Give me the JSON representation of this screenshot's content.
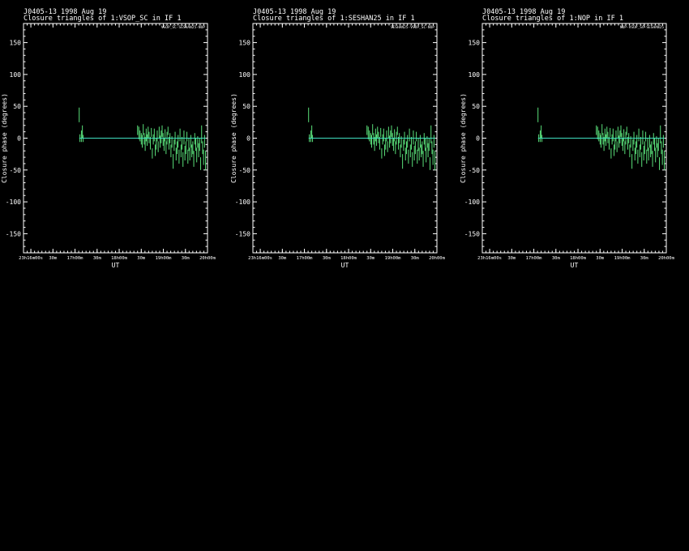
{
  "chart_data": [
    {
      "type": "scatter",
      "header": "J0405-13  1998 Aug 19",
      "title": "Closure triangles of 1:VSOP_SC in IF 1",
      "corner_label": "VSOP_SC-SESHAN25-NOP",
      "xlabel": "UT",
      "ylabel": "Closure phase   (degrees)",
      "ylim": [
        -180,
        180
      ],
      "yticks": [
        -150,
        -100,
        -50,
        0,
        50,
        100,
        150
      ],
      "xlim": [
        -60,
        1440
      ],
      "xticks": [
        0,
        180,
        360,
        540,
        720,
        900,
        1080,
        1260,
        1440
      ],
      "xtick_labels": [
        "23h16m00s",
        "30m",
        "17h00m",
        "30m",
        "18h00m",
        "30m",
        "19h00m",
        "30m",
        "20h00m"
      ],
      "model_line": {
        "y": 0,
        "x_start": 394,
        "x_end": 1425,
        "color": "#40e0c0"
      },
      "bar_color": "#5ae07a"
    },
    {
      "type": "scatter",
      "header": "J0405-13  1998 Aug 19",
      "title": "Closure triangles of 1:SESHAN25 in IF 1",
      "corner_label": "SESHAN25-VSOP_SC-NOP",
      "xlabel": "UT",
      "ylabel": "Closure phase   (degrees)",
      "ylim": [
        -180,
        180
      ],
      "yticks": [
        -150,
        -100,
        -50,
        0,
        50,
        100,
        150
      ],
      "xlim": [
        -60,
        1440
      ],
      "xticks": [
        0,
        180,
        360,
        540,
        720,
        900,
        1080,
        1260,
        1440
      ],
      "xtick_labels": [
        "23h16m00s",
        "30m",
        "17h00m",
        "30m",
        "18h00m",
        "30m",
        "19h00m",
        "30m",
        "20h00m"
      ],
      "model_line": {
        "y": 0,
        "x_start": 394,
        "x_end": 1425,
        "color": "#40e0c0"
      },
      "bar_color": "#5ae07a"
    },
    {
      "type": "scatter",
      "header": "J0405-13  1998 Aug 19",
      "title": "Closure triangles of 1:NOP in IF 1",
      "corner_label": "NOP-VSOP_SC-SESHAN25",
      "xlabel": "UT",
      "ylabel": "Closure phase   (degrees)",
      "ylim": [
        -180,
        180
      ],
      "yticks": [
        -150,
        -100,
        -50,
        0,
        50,
        100,
        150
      ],
      "xlim": [
        -60,
        1440
      ],
      "xticks": [
        0,
        180,
        360,
        540,
        720,
        900,
        1080,
        1260,
        1440
      ],
      "xtick_labels": [
        "23h16m00s",
        "30m",
        "17h00m",
        "30m",
        "18h00m",
        "30m",
        "19h00m",
        "30m",
        "20h00m"
      ],
      "model_line": {
        "y": 0,
        "x_start": 394,
        "x_end": 1425,
        "color": "#40e0c0"
      },
      "bar_color": "#5ae07a"
    }
  ],
  "points": [
    {
      "x": 394,
      "lo": 25,
      "hi": 48
    },
    {
      "x": 400,
      "lo": -6,
      "hi": 6
    },
    {
      "x": 412,
      "lo": -6,
      "hi": 12
    },
    {
      "x": 420,
      "lo": 0,
      "hi": 20
    },
    {
      "x": 426,
      "lo": -6,
      "hi": 5
    },
    {
      "x": 870,
      "lo": 5,
      "hi": 20
    },
    {
      "x": 880,
      "lo": -2,
      "hi": 18
    },
    {
      "x": 890,
      "lo": -5,
      "hi": 12
    },
    {
      "x": 900,
      "lo": -10,
      "hi": 8
    },
    {
      "x": 908,
      "lo": -15,
      "hi": 5
    },
    {
      "x": 916,
      "lo": 5,
      "hi": 22
    },
    {
      "x": 924,
      "lo": -10,
      "hi": 8
    },
    {
      "x": 932,
      "lo": -20,
      "hi": 2
    },
    {
      "x": 940,
      "lo": -5,
      "hi": 15
    },
    {
      "x": 948,
      "lo": -12,
      "hi": 6
    },
    {
      "x": 956,
      "lo": 0,
      "hi": 18
    },
    {
      "x": 964,
      "lo": -8,
      "hi": 10
    },
    {
      "x": 974,
      "lo": -18,
      "hi": 2
    },
    {
      "x": 982,
      "lo": 2,
      "hi": 16
    },
    {
      "x": 990,
      "lo": -32,
      "hi": -16
    },
    {
      "x": 998,
      "lo": -10,
      "hi": 6
    },
    {
      "x": 1006,
      "lo": -5,
      "hi": 15
    },
    {
      "x": 1014,
      "lo": -28,
      "hi": -10
    },
    {
      "x": 1022,
      "lo": -18,
      "hi": 0
    },
    {
      "x": 1030,
      "lo": -5,
      "hi": 12
    },
    {
      "x": 1038,
      "lo": -22,
      "hi": -5
    },
    {
      "x": 1046,
      "lo": 0,
      "hi": 18
    },
    {
      "x": 1054,
      "lo": -15,
      "hi": 4
    },
    {
      "x": 1062,
      "lo": -8,
      "hi": 12
    },
    {
      "x": 1070,
      "lo": 2,
      "hi": 20
    },
    {
      "x": 1078,
      "lo": -12,
      "hi": 8
    },
    {
      "x": 1086,
      "lo": -20,
      "hi": 0
    },
    {
      "x": 1094,
      "lo": -5,
      "hi": 14
    },
    {
      "x": 1102,
      "lo": -25,
      "hi": -5
    },
    {
      "x": 1110,
      "lo": -10,
      "hi": 10
    },
    {
      "x": 1118,
      "lo": 5,
      "hi": 18
    },
    {
      "x": 1126,
      "lo": -18,
      "hi": 2
    },
    {
      "x": 1134,
      "lo": -8,
      "hi": 8
    },
    {
      "x": 1142,
      "lo": -30,
      "hi": -10
    },
    {
      "x": 1150,
      "lo": -15,
      "hi": 3
    },
    {
      "x": 1160,
      "lo": -48,
      "hi": -25
    },
    {
      "x": 1168,
      "lo": -20,
      "hi": -2
    },
    {
      "x": 1176,
      "lo": -10,
      "hi": 10
    },
    {
      "x": 1184,
      "lo": -35,
      "hi": -15
    },
    {
      "x": 1192,
      "lo": -25,
      "hi": -5
    },
    {
      "x": 1200,
      "lo": -15,
      "hi": 5
    },
    {
      "x": 1208,
      "lo": -40,
      "hi": -18
    },
    {
      "x": 1216,
      "lo": -5,
      "hi": 15
    },
    {
      "x": 1224,
      "lo": -30,
      "hi": -10
    },
    {
      "x": 1232,
      "lo": -18,
      "hi": 2
    },
    {
      "x": 1240,
      "lo": -45,
      "hi": -22
    },
    {
      "x": 1248,
      "lo": -10,
      "hi": 12
    },
    {
      "x": 1256,
      "lo": -35,
      "hi": -12
    },
    {
      "x": 1264,
      "lo": -25,
      "hi": -5
    },
    {
      "x": 1272,
      "lo": -5,
      "hi": 10
    },
    {
      "x": 1280,
      "lo": -40,
      "hi": -18
    },
    {
      "x": 1288,
      "lo": -20,
      "hi": 0
    },
    {
      "x": 1296,
      "lo": -35,
      "hi": -15
    },
    {
      "x": 1304,
      "lo": -15,
      "hi": 5
    },
    {
      "x": 1312,
      "lo": -30,
      "hi": -10
    },
    {
      "x": 1320,
      "lo": -25,
      "hi": -5
    },
    {
      "x": 1328,
      "lo": -45,
      "hi": -20
    },
    {
      "x": 1336,
      "lo": -10,
      "hi": 8
    },
    {
      "x": 1344,
      "lo": -20,
      "hi": 0
    },
    {
      "x": 1352,
      "lo": -38,
      "hi": -15
    },
    {
      "x": 1360,
      "lo": -15,
      "hi": 3
    },
    {
      "x": 1368,
      "lo": -30,
      "hi": -8
    },
    {
      "x": 1376,
      "lo": -20,
      "hi": 0
    },
    {
      "x": 1384,
      "lo": -50,
      "hi": -30
    },
    {
      "x": 1392,
      "lo": -8,
      "hi": 20
    },
    {
      "x": 1400,
      "lo": -25,
      "hi": -5
    },
    {
      "x": 1408,
      "lo": -42,
      "hi": -18
    },
    {
      "x": 1416,
      "lo": -15,
      "hi": 5
    },
    {
      "x": 1424,
      "lo": -50,
      "hi": -20
    }
  ]
}
